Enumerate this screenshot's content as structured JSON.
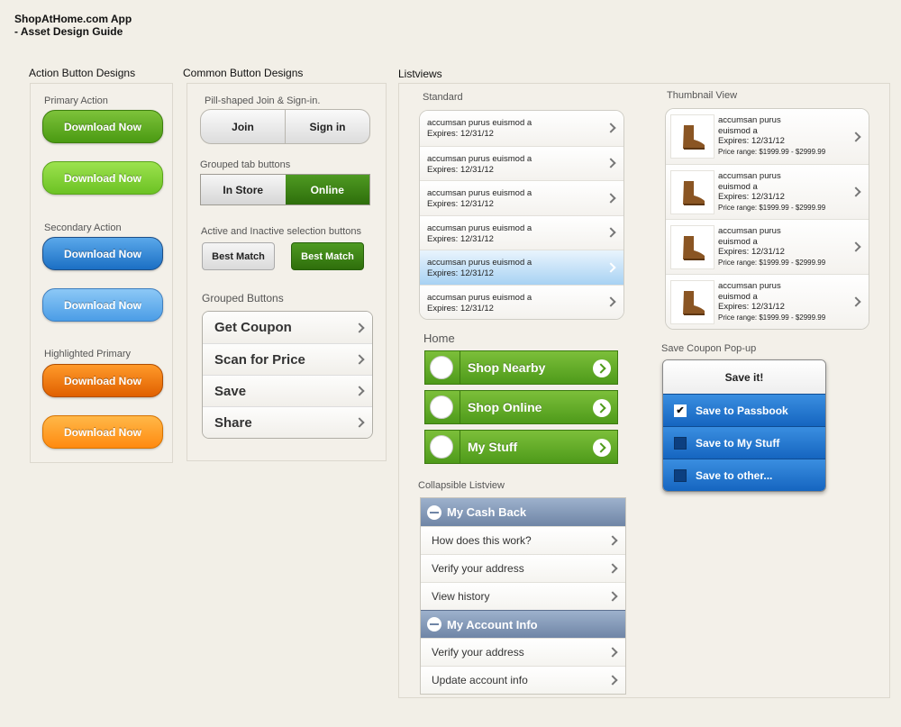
{
  "header": {
    "title_line1": "ShopAtHome.com App",
    "title_line2": "- Asset Design Guide"
  },
  "sections": {
    "action": "Action Button Designs",
    "common": "Common Button Designs",
    "listviews": "Listviews"
  },
  "action": {
    "primary_label": "Primary Action",
    "secondary_label": "Secondary Action",
    "highlighted_label": "Highlighted Primary",
    "button_text": "Download Now"
  },
  "common": {
    "pill_label": "Pill-shaped Join & Sign-in.",
    "join": "Join",
    "signin": "Sign in",
    "tab_label": "Grouped tab buttons",
    "tab_instore": "In Store",
    "tab_online": "Online",
    "sel_label": "Active and Inactive selection buttons",
    "best_match": "Best Match",
    "grouped_label": "Grouped Buttons",
    "grouped_items": [
      "Get Coupon",
      "Scan for Price",
      "Save",
      "Share"
    ]
  },
  "listviews": {
    "standard_label": "Standard",
    "standard_items": [
      {
        "line1": "accumsan purus euismod a",
        "line2": "Expires: 12/31/12"
      },
      {
        "line1": "accumsan purus euismod a",
        "line2": "Expires: 12/31/12"
      },
      {
        "line1": "accumsan purus euismod a",
        "line2": "Expires: 12/31/12"
      },
      {
        "line1": "accumsan purus euismod a",
        "line2": "Expires: 12/31/12"
      },
      {
        "line1": "accumsan purus euismod a",
        "line2": "Expires: 12/31/12"
      },
      {
        "line1": "accumsan purus euismod a",
        "line2": "Expires: 12/31/12"
      }
    ],
    "thumbnail_label": "Thumbnail View",
    "thumbnail_items": [
      {
        "line1": "accumsan purus",
        "line2": "euismod a",
        "line3": "Expires: 12/31/12",
        "price": "Price range: $1999.99 - $2999.99"
      },
      {
        "line1": "accumsan purus",
        "line2": "euismod a",
        "line3": "Expires: 12/31/12",
        "price": "Price range: $1999.99 - $2999.99"
      },
      {
        "line1": "accumsan purus",
        "line2": "euismod a",
        "line3": "Expires: 12/31/12",
        "price": "Price range: $1999.99 - $2999.99"
      },
      {
        "line1": "accumsan purus",
        "line2": "euismod a",
        "line3": "Expires: 12/31/12",
        "price": "Price range: $1999.99 - $2999.99"
      }
    ],
    "home_label": "Home",
    "home_items": [
      "Shop Nearby",
      "Shop Online",
      "My Stuff"
    ],
    "collapsible_label": "Collapsible Listview",
    "collapsible": {
      "head1": "My Cash Back",
      "rows1": [
        "How does this work?",
        "Verify your address",
        "View history"
      ],
      "head2": "My Account Info",
      "rows2": [
        "Verify your address",
        "Update account info"
      ]
    },
    "popup_label": "Save Coupon Pop-up",
    "popup": {
      "title": "Save it!",
      "options": [
        "Save to Passbook",
        "Save to My Stuff",
        "Save to other..."
      ]
    }
  }
}
